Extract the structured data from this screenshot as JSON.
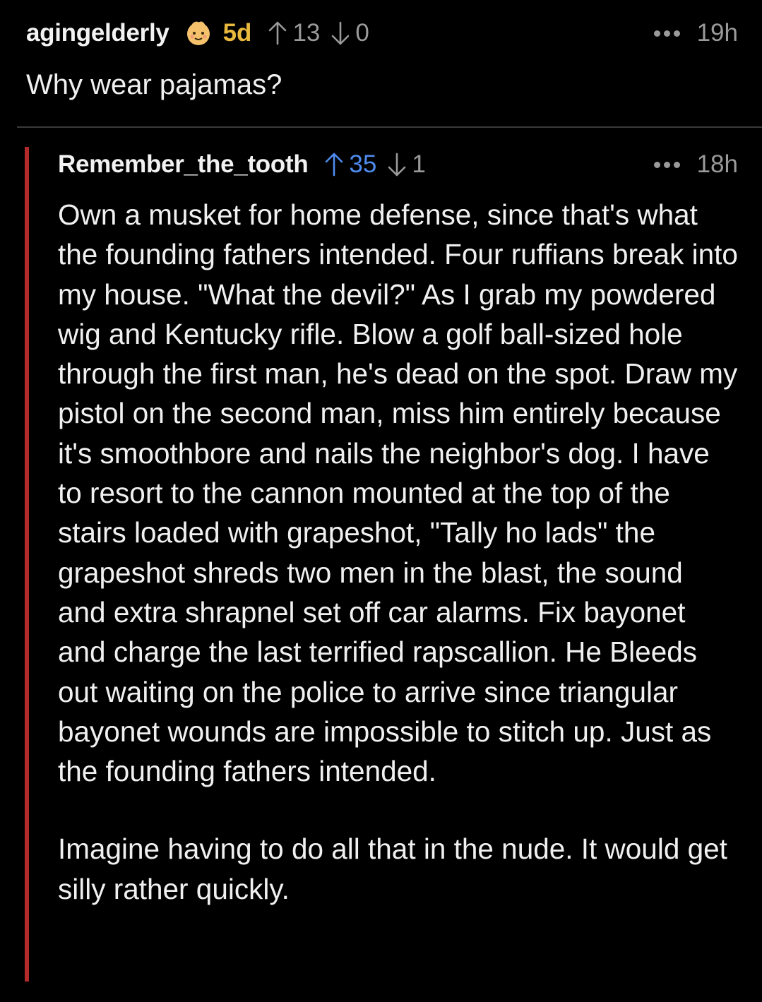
{
  "parent_comment": {
    "username": "agingelderly",
    "flair_icon": "baby-face-icon",
    "account_age": "5d",
    "upvotes": "13",
    "downvotes": "0",
    "time": "19h",
    "body": "Why wear pajamas?"
  },
  "reply_comment": {
    "username": "Remember_the_tooth",
    "upvotes": "35",
    "downvotes": "1",
    "time": "18h",
    "paragraphs": [
      "Own a musket for home defense, since that's what the founding fathers intended. Four ruffians break into my house. \"What the devil?\" As I grab my powdered wig and Kentucky rifle. Blow a golf ball-sized hole through the first man, he's dead on the spot. Draw my pistol on the second man, miss him entirely because it's smoothbore and nails the neighbor's dog. I have to resort to the cannon mounted at the top of the stairs loaded with grapeshot, \"Tally ho lads\" the grapeshot shreds two men in the blast, the sound and extra shrapnel set off car alarms. Fix bayonet and charge the last terrified rapscallion. He Bleeds out waiting on the police to arrive since triangular bayonet wounds are impossible to stitch up. Just as the founding fathers intended.",
      "Imagine having to do all that in the nude. It would get silly rather quickly."
    ]
  },
  "colors": {
    "background": "#000000",
    "age_badge": "#e8b93c",
    "upvoted": "#4f8cf0",
    "thread_line": "#b22a2a",
    "muted": "#9a9a9a"
  }
}
